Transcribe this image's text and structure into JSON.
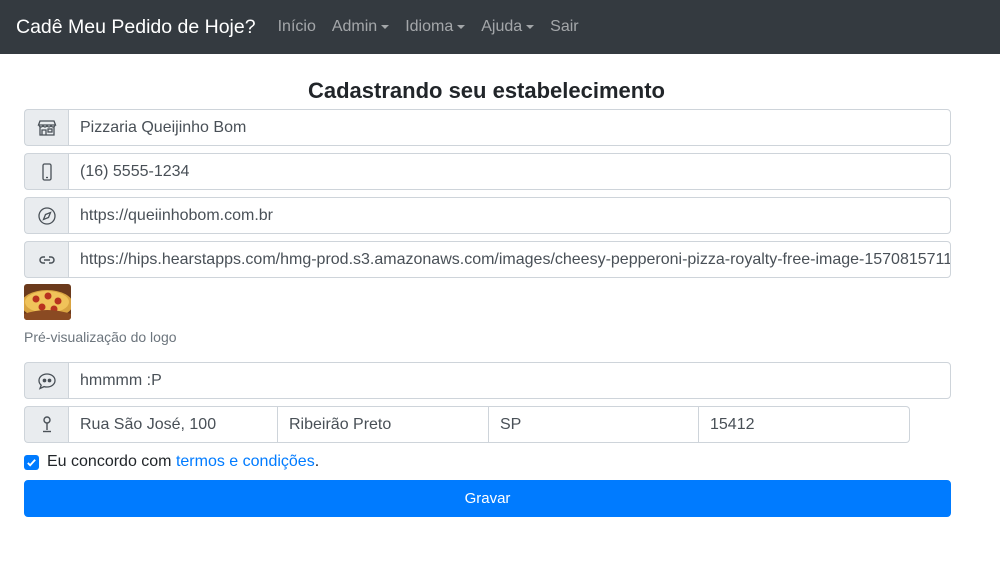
{
  "navbar": {
    "brand": "Cadê Meu Pedido de Hoje?",
    "items": [
      {
        "label": "Início"
      },
      {
        "label": "Admin"
      },
      {
        "label": "Idioma"
      },
      {
        "label": "Ajuda"
      },
      {
        "label": "Sair"
      }
    ]
  },
  "form": {
    "title": "Cadastrando seu estabelecimento",
    "name": {
      "icon": "shop-icon",
      "value": "Pizzaria Queijinho Bom"
    },
    "phone": {
      "icon": "phone-icon",
      "value": "(16) 5555-1234"
    },
    "website": {
      "icon": "compass-icon",
      "value": "https://queiinhobom.com.br"
    },
    "logo_url": {
      "icon": "link-icon",
      "value": "https://hips.hearstapps.com/hmg-prod.s3.amazonaws.com/images/cheesy-pepperoni-pizza-royalty-free-image-1570815711"
    },
    "logo_preview_label": "Pré-visualização do logo",
    "slogan": {
      "icon": "quote-icon",
      "value": "hmmmm :P"
    },
    "address": {
      "icon": "pin-icon",
      "street": "Rua São José, 100",
      "city": "Ribeirão Preto",
      "state": "SP",
      "zip": "15412"
    },
    "agree": {
      "checked": true,
      "text_before": "Eu concordo com ",
      "link_text": "termos e condições",
      "text_after": "."
    },
    "submit_label": "Gravar"
  },
  "colors": {
    "navbar": "#343a40",
    "primary": "#007bff",
    "addon_bg": "#e9ecef",
    "border": "#ced4da"
  }
}
